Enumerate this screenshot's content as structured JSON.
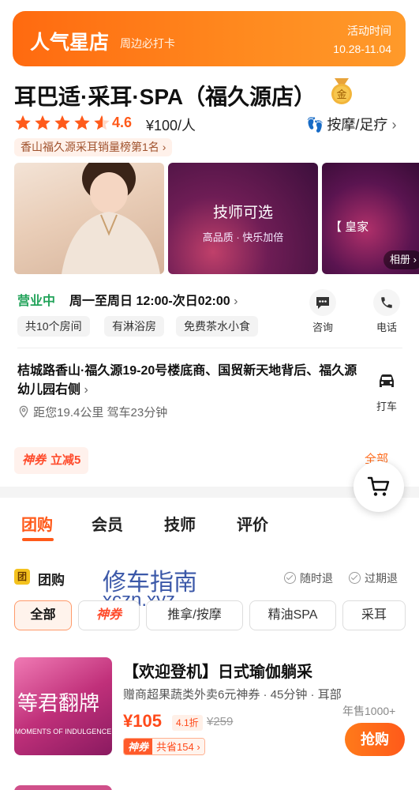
{
  "banner": {
    "title": "人气星店",
    "subtitle": "周边必打卡",
    "activity_label": "活动时间",
    "activity_dates": "10.28-11.04"
  },
  "shop": {
    "name": "耳巴适·采耳·SPA（福久源店）",
    "rating": "4.6",
    "rating_value": 4.6,
    "price": "¥100/人",
    "category": "按摩/足疗",
    "rank_tag": "香山福久源采耳销量榜第1名"
  },
  "photos": {
    "p2_title": "技师可选",
    "p2_subtitle": "高品质 · 快乐加倍",
    "p3_text": "【 皇家",
    "album_label": "相册"
  },
  "hours": {
    "status": "营业中",
    "text": "周一至周日 12:00-次日02:00"
  },
  "facilities": [
    "共10个房间",
    "有淋浴房",
    "免费茶水小食"
  ],
  "actions": {
    "consult": "咨询",
    "call": "电话",
    "taxi": "打车"
  },
  "address": {
    "text": "桔城路香山·福久源19-20号楼底商、国贸新天地背后、福久源幼儿园右侧",
    "distance": "距您19.4公里 驾车23分钟"
  },
  "coupon": {
    "brand": "神券",
    "text": "立减5",
    "all_link": "全部"
  },
  "tabs": [
    "团购",
    "会员",
    "技师",
    "评价"
  ],
  "group": {
    "icon": "团",
    "title": "团购",
    "policy1": "随时退",
    "policy2": "过期退"
  },
  "watermark": {
    "line1": "修车指南",
    "line2": "xczn.xyz"
  },
  "filters": [
    "全部",
    "神券",
    "推拿/按摩",
    "精油SPA",
    "采耳"
  ],
  "deal": {
    "image_big": "等君翻牌",
    "image_small": "MOMENTS OF INDULGENCE",
    "title": "【欢迎登机】日式瑜伽躺采",
    "desc": "赠商超果蔬类外卖6元神券 · 45分钟 · 耳部",
    "price": "¥105",
    "discount": "4.1折",
    "original": "¥259",
    "sold": "年售1000+",
    "save_brand": "神券",
    "save_text": "共省154",
    "buy_label": "抢购"
  },
  "colors": {
    "brand_orange": "#ff5a1a",
    "open_green": "#22a35a",
    "banner_gradient_start": "#ff6a10"
  }
}
